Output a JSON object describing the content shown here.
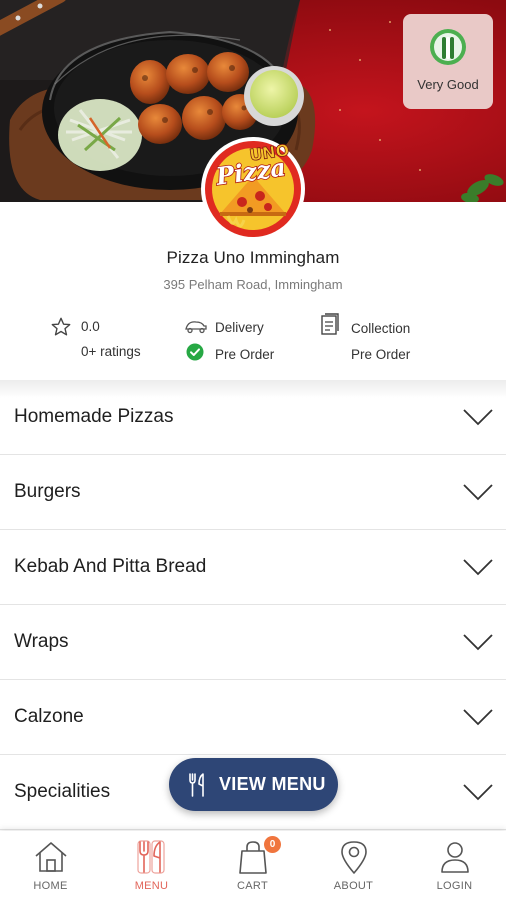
{
  "hero": {
    "hygiene_rating": {
      "label": "Very Good",
      "icon": "fhrs-rating-icon",
      "color": "#4caf50"
    },
    "logo": {
      "line1": "UNO",
      "line2": "Pizza",
      "icon": "pizza-uno-logo"
    }
  },
  "restaurant": {
    "name": "Pizza Uno Immingham",
    "address": "395 Pelham Road, Immingham"
  },
  "info": {
    "rating": {
      "value": "0.0",
      "count_label": "0+ ratings",
      "icon": "star-icon"
    },
    "delivery": {
      "label": "Delivery",
      "status": "Pre Order",
      "icon": "delivery-icon",
      "status_icon": "check-circle-icon",
      "status_color": "#27a844"
    },
    "collection": {
      "label": "Collection",
      "status": "Pre Order",
      "icon": "collection-icon"
    }
  },
  "categories": [
    {
      "label": "Homemade Pizzas"
    },
    {
      "label": "Burgers"
    },
    {
      "label": "Kebab And Pitta Bread"
    },
    {
      "label": "Wraps"
    },
    {
      "label": "Calzone"
    },
    {
      "label": "Specialities"
    }
  ],
  "view_menu": {
    "label": "VIEW MENU",
    "icon": "cutlery-icon",
    "color": "#2e4676"
  },
  "nav": {
    "active": "menu",
    "accent_color": "#e2655a",
    "items": [
      {
        "key": "home",
        "label": "HOME",
        "icon": "home-icon"
      },
      {
        "key": "menu",
        "label": "MENU",
        "icon": "cutlery-icon"
      },
      {
        "key": "cart",
        "label": "CART",
        "icon": "shopping-bag-icon",
        "badge": "0"
      },
      {
        "key": "about",
        "label": "ABOUT",
        "icon": "location-pin-icon"
      },
      {
        "key": "login",
        "label": "LOGIN",
        "icon": "user-icon"
      }
    ]
  }
}
